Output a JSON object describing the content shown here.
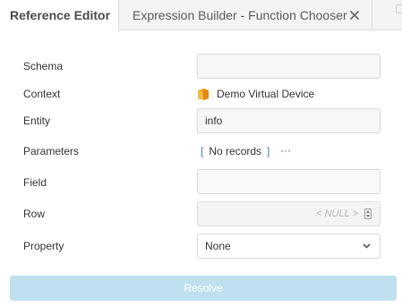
{
  "tabs": [
    {
      "label": "Reference Editor",
      "active": true
    },
    {
      "label": "Expression Builder - Function Chooser",
      "active": false,
      "closable": true
    }
  ],
  "form": {
    "schema": {
      "label": "Schema",
      "value": ""
    },
    "context": {
      "label": "Context",
      "value": "Demo Virtual Device",
      "icon": "device-icon"
    },
    "entity": {
      "label": "Entity",
      "value": "info"
    },
    "parameters": {
      "label": "Parameters",
      "value": "No records",
      "open_bracket": "[",
      "close_bracket": "]",
      "more": "···"
    },
    "field": {
      "label": "Field",
      "value": ""
    },
    "row": {
      "label": "Row",
      "placeholder": "< NULL >"
    },
    "property": {
      "label": "Property",
      "value": "None"
    }
  },
  "actions": {
    "resolve_label": "Resolve"
  },
  "colors": {
    "accent_disabled": "#bfe1ef",
    "bracket": "#4a74b0",
    "device_icon": "#f39c12"
  }
}
